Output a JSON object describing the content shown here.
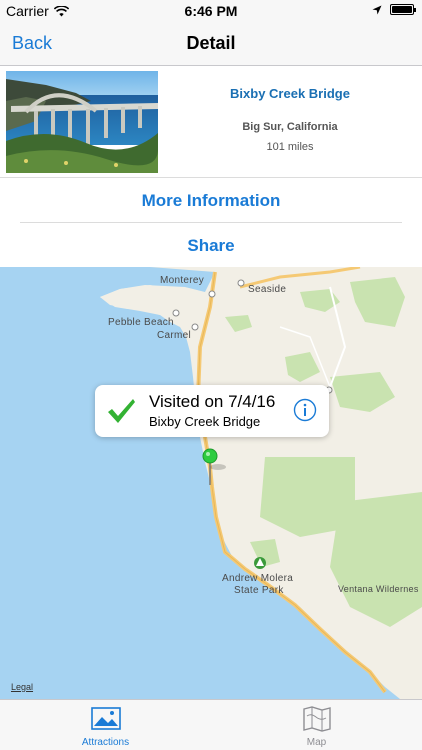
{
  "status_bar": {
    "carrier": "Carrier",
    "time": "6:46 PM"
  },
  "nav": {
    "back_label": "Back",
    "title": "Detail"
  },
  "attraction": {
    "name": "Bixby Creek Bridge",
    "location": "Big Sur, California",
    "distance": "101 miles"
  },
  "actions": {
    "more_info": "More Information",
    "share": "Share"
  },
  "map": {
    "labels": {
      "monterey": "Monterey",
      "seaside": "Seaside",
      "pebble_beach": "Pebble Beach",
      "carmel": "Carmel",
      "andrew_molera": "Andrew Molera",
      "state_park": "State Park",
      "ventana": "Ventana Wildernes"
    },
    "legal": "Legal",
    "callout": {
      "title": "Visited on 7/4/16",
      "subtitle": "Bixby Creek Bridge"
    }
  },
  "tabs": [
    {
      "label": "Attractions",
      "icon": "photo-icon",
      "selected": true
    },
    {
      "label": "Map",
      "icon": "map-icon",
      "selected": false
    }
  ],
  "colors": {
    "accent": "#1a7bd6",
    "water": "#a6d3f2",
    "land": "#f2efe6",
    "park": "#c9e3b0",
    "road": "#f5c974",
    "pin": "#2ecc40"
  }
}
